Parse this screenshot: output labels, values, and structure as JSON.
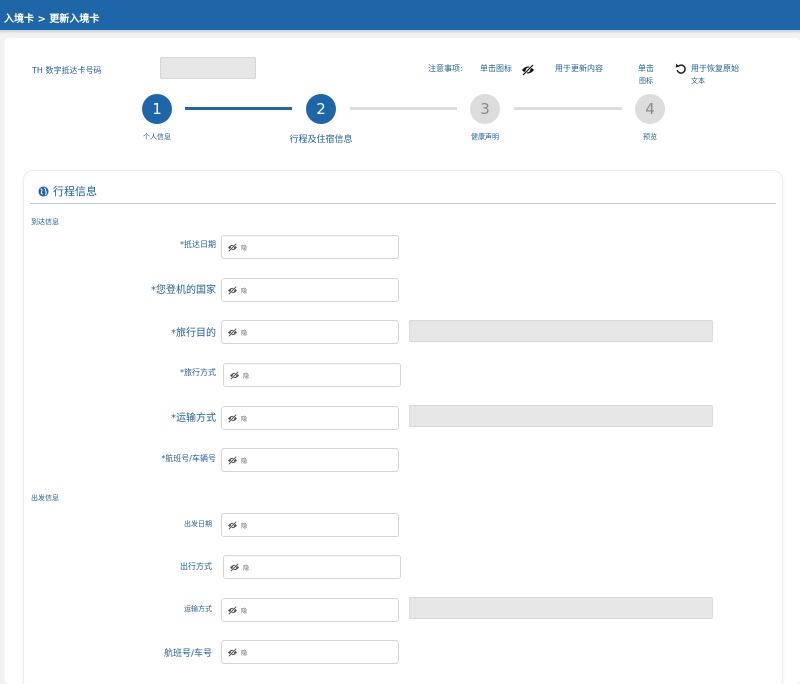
{
  "breadcrumb": "入境卡 > 更新入境卡",
  "header": {
    "card_number_label": "TH 数字抵达卡号码",
    "notes_label": "注意事项:",
    "click_icon": "单击图标",
    "update_content": "用于更新内容",
    "click": "单击",
    "icon": "图标",
    "restore_text_line1": "用于恢复原始",
    "restore_text_line2": "文本"
  },
  "steps": [
    {
      "num": "1",
      "label": "个人信息",
      "state": "active"
    },
    {
      "num": "2",
      "label": "行程及住宿信息",
      "state": "active"
    },
    {
      "num": "3",
      "label": "健康声明",
      "state": "inactive"
    },
    {
      "num": "4",
      "label": "预览",
      "state": "inactive"
    }
  ],
  "panel": {
    "title": "行程信息",
    "arrival_section": "到达信息",
    "departure_section": "出发信息",
    "field_tag": "隐"
  },
  "arrival_fields": [
    {
      "label": "*抵达日期"
    },
    {
      "label": "*您登机的国家"
    },
    {
      "label": "*旅行目的"
    },
    {
      "label": "*旅行方式"
    },
    {
      "label": "*运输方式"
    },
    {
      "label": "*航班号/车辆号"
    }
  ],
  "departure_fields": [
    {
      "label": "出发日期"
    },
    {
      "label": "出行方式"
    },
    {
      "label": "运输方式"
    },
    {
      "label": "航班号/车号"
    }
  ],
  "colors": {
    "primary": "#1f66a8",
    "inactive": "#dcdcdc",
    "field_gray": "#e6e6e6"
  }
}
